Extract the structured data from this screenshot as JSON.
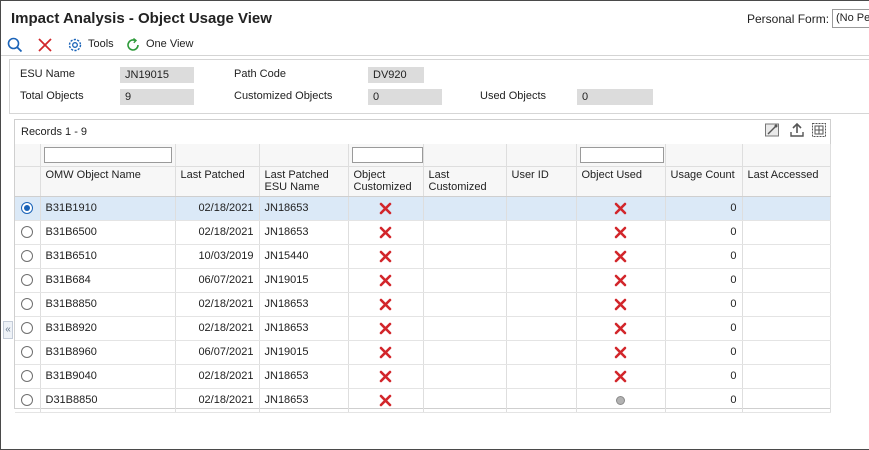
{
  "window": {
    "title": "Impact Analysis - Object Usage View",
    "personal_form_label": "Personal Form:",
    "personal_form_value": "(No Personal Form)"
  },
  "toolbar": {
    "find_icon": "search-icon",
    "close_icon": "close-icon",
    "tools_label": "Tools",
    "tools_icon": "gear-icon",
    "one_view_label": "One View",
    "one_view_icon": "refresh-circle-icon"
  },
  "header": {
    "esu_name_label": "ESU Name",
    "esu_name_value": "JN19015",
    "path_code_label": "Path Code",
    "path_code_value": "DV920",
    "total_objects_label": "Total Objects",
    "total_objects_value": "9",
    "customized_objects_label": "Customized Objects",
    "customized_objects_value": "0",
    "used_objects_label": "Used Objects",
    "used_objects_value": "0"
  },
  "grid": {
    "records_label": "Records 1 - 9",
    "columns": [
      {
        "key": "name",
        "label": "OMW Object Name"
      },
      {
        "key": "last_patched",
        "label": "Last Patched"
      },
      {
        "key": "esu",
        "label": "Last Patched ESU Name"
      },
      {
        "key": "customized",
        "label": "Object Customized"
      },
      {
        "key": "last_customized",
        "label": "Last Customized"
      },
      {
        "key": "user_id",
        "label": "User ID"
      },
      {
        "key": "used",
        "label": "Object Used"
      },
      {
        "key": "usage_count",
        "label": "Usage Count"
      },
      {
        "key": "last_accessed",
        "label": "Last Accessed"
      }
    ],
    "rows": [
      {
        "name": "B31B1910",
        "last_patched": "02/18/2021",
        "esu": "JN18653",
        "customized": "x",
        "last_customized": "",
        "user_id": "",
        "used": "x",
        "usage_count": "0",
        "last_accessed": "",
        "selected": true
      },
      {
        "name": "B31B6500",
        "last_patched": "02/18/2021",
        "esu": "JN18653",
        "customized": "x",
        "last_customized": "",
        "user_id": "",
        "used": "x",
        "usage_count": "0",
        "last_accessed": "",
        "selected": false
      },
      {
        "name": "B31B6510",
        "last_patched": "10/03/2019",
        "esu": "JN15440",
        "customized": "x",
        "last_customized": "",
        "user_id": "",
        "used": "x",
        "usage_count": "0",
        "last_accessed": "",
        "selected": false
      },
      {
        "name": "B31B684",
        "last_patched": "06/07/2021",
        "esu": "JN19015",
        "customized": "x",
        "last_customized": "",
        "user_id": "",
        "used": "x",
        "usage_count": "0",
        "last_accessed": "",
        "selected": false
      },
      {
        "name": "B31B8850",
        "last_patched": "02/18/2021",
        "esu": "JN18653",
        "customized": "x",
        "last_customized": "",
        "user_id": "",
        "used": "x",
        "usage_count": "0",
        "last_accessed": "",
        "selected": false
      },
      {
        "name": "B31B8920",
        "last_patched": "02/18/2021",
        "esu": "JN18653",
        "customized": "x",
        "last_customized": "",
        "user_id": "",
        "used": "x",
        "usage_count": "0",
        "last_accessed": "",
        "selected": false
      },
      {
        "name": "B31B8960",
        "last_patched": "06/07/2021",
        "esu": "JN19015",
        "customized": "x",
        "last_customized": "",
        "user_id": "",
        "used": "x",
        "usage_count": "0",
        "last_accessed": "",
        "selected": false
      },
      {
        "name": "B31B9040",
        "last_patched": "02/18/2021",
        "esu": "JN18653",
        "customized": "x",
        "last_customized": "",
        "user_id": "",
        "used": "x",
        "usage_count": "0",
        "last_accessed": "",
        "selected": false
      },
      {
        "name": "D31B8850",
        "last_patched": "02/18/2021",
        "esu": "JN18653",
        "customized": "x",
        "last_customized": "",
        "user_id": "",
        "used": "dot",
        "usage_count": "0",
        "last_accessed": "",
        "selected": false
      }
    ]
  },
  "colors": {
    "accent_blue": "#1a63b8",
    "x_red": "#d2262b",
    "selected_row": "#dbe9f7",
    "readonly_field": "#dcdcdc"
  }
}
